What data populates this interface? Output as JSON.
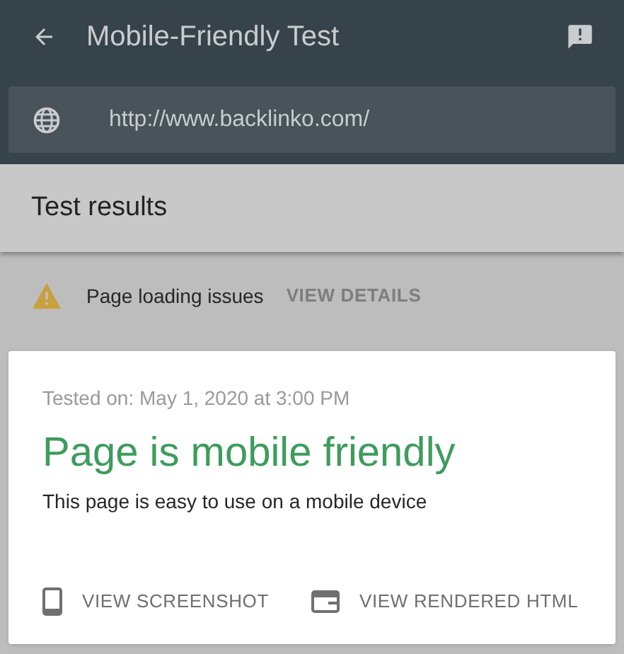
{
  "app_bar": {
    "title": "Mobile-Friendly Test"
  },
  "url_field": {
    "value": "http://www.backlinko.com/"
  },
  "section": {
    "title": "Test results"
  },
  "issue": {
    "text": "Page loading issues",
    "action": "VIEW DETAILS"
  },
  "result_card": {
    "tested_on": "Tested on: May 1, 2020 at 3:00 PM",
    "headline": "Page is mobile friendly",
    "description": "This page is easy to use on a mobile device",
    "actions": [
      {
        "kind": "screenshot",
        "label": "VIEW SCREENSHOT"
      },
      {
        "kind": "html",
        "label": "VIEW RENDERED HTML"
      }
    ]
  }
}
